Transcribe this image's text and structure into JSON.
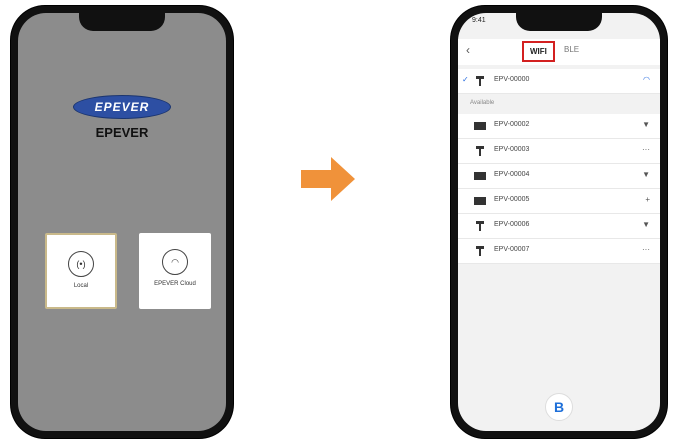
{
  "left_phone": {
    "logo_text": "EPEVER",
    "brand_name": "EPEVER",
    "cards": [
      {
        "icon": "local-icon",
        "glyph": "(•)",
        "label": "Local"
      },
      {
        "icon": "cloud-icon",
        "glyph": "◠",
        "label": "EPEVER Cloud"
      }
    ]
  },
  "right_phone": {
    "status_time": "9:41",
    "tabs": {
      "wifi": "WIFI",
      "bluetooth": "BLE"
    },
    "connected_device": "EPV-00000",
    "section_label": "Available",
    "devices": [
      {
        "name": "EPV-00002",
        "type": "box",
        "signal": "▼"
      },
      {
        "name": "EPV-00003",
        "type": "tower",
        "signal": "···"
      },
      {
        "name": "EPV-00004",
        "type": "box",
        "signal": "▼"
      },
      {
        "name": "EPV-00005",
        "type": "box",
        "signal": "+"
      },
      {
        "name": "EPV-00006",
        "type": "tower",
        "signal": "▼"
      },
      {
        "name": "EPV-00007",
        "type": "tower",
        "signal": "···"
      }
    ],
    "bottom_button": "B"
  },
  "colors": {
    "accent": "#f0923a",
    "highlight": "#d32020",
    "brand": "#2d4fa3"
  }
}
